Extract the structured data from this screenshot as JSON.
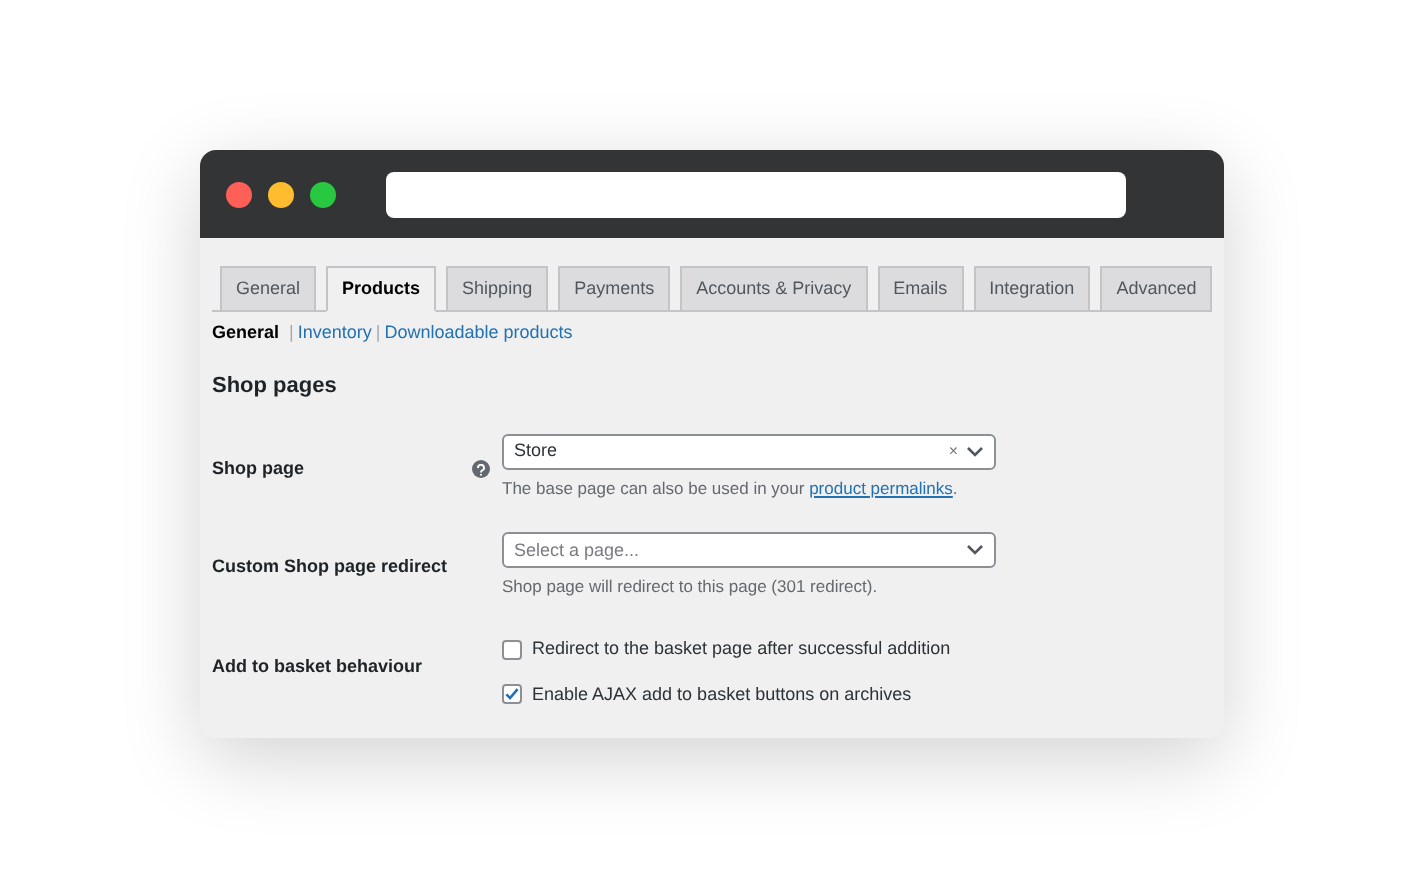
{
  "tabs": [
    {
      "label": "General",
      "selected": false
    },
    {
      "label": "Products",
      "selected": true
    },
    {
      "label": "Shipping",
      "selected": false
    },
    {
      "label": "Payments",
      "selected": false
    },
    {
      "label": "Accounts & Privacy",
      "selected": false
    },
    {
      "label": "Emails",
      "selected": false
    },
    {
      "label": "Integration",
      "selected": false
    },
    {
      "label": "Advanced",
      "selected": false
    }
  ],
  "subnav": [
    {
      "label": "General",
      "selected": true
    },
    {
      "separator": "|",
      "label": "Inventory",
      "selected": false
    },
    {
      "separator": "|",
      "label": "Downloadable products",
      "selected": false
    }
  ],
  "section_title": "Shop pages",
  "settings": [
    {
      "kind": "select",
      "label": "Shop page",
      "help": true,
      "value": "Store",
      "clear": "×",
      "description": {
        "before": "The base page can also be used in your ",
        "link": "product permalinks",
        "after": "."
      }
    },
    {
      "kind": "select",
      "label": "Custom Shop page redirect",
      "help": false,
      "placeholder": "Select a page...",
      "description": {
        "before": "Shop page will redirect to this page (301 redirect)."
      }
    },
    {
      "kind": "checkboxes",
      "label": "Add to basket behaviour",
      "options": [
        {
          "label": "Redirect to the basket page after successful addition",
          "checked": false
        },
        {
          "label": "Enable AJAX add to basket buttons on archives",
          "checked": true
        }
      ]
    }
  ]
}
